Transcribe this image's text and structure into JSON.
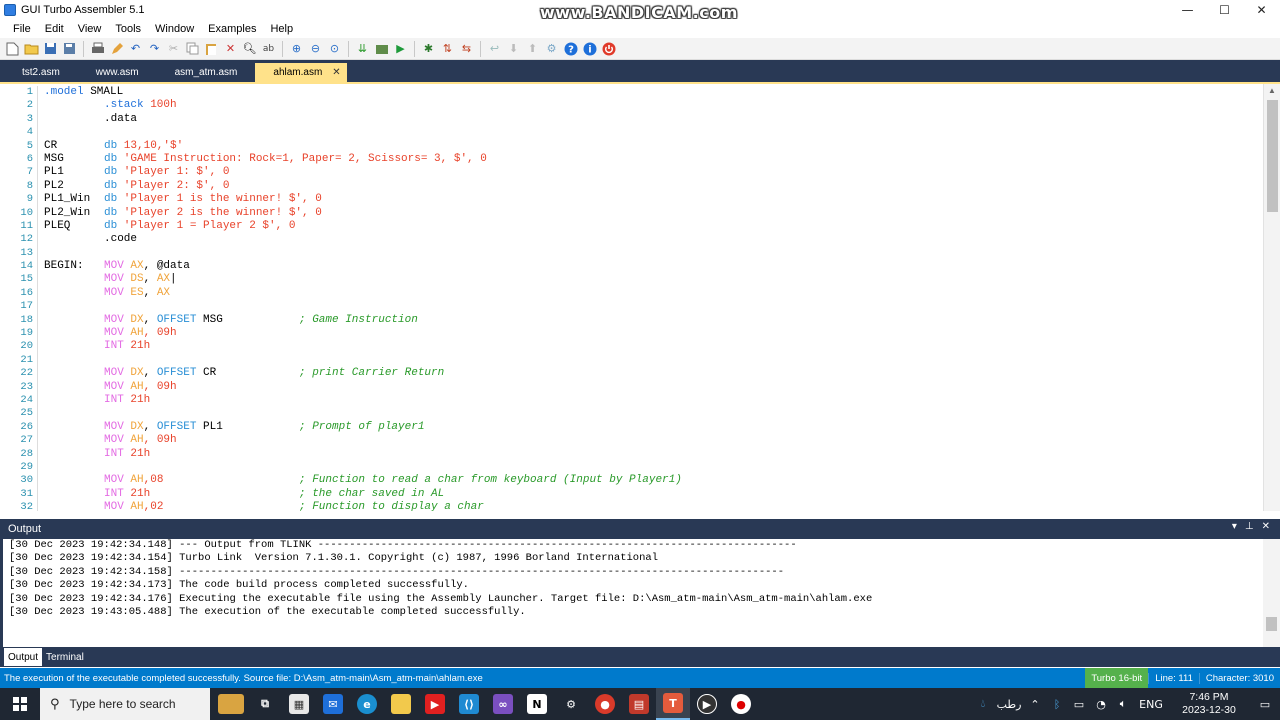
{
  "window": {
    "title": "GUI Turbo Assembler 5.1",
    "watermark": "www.BANDICAM.com",
    "controls": [
      "—",
      "☐",
      "✕"
    ]
  },
  "menu": [
    "File",
    "Edit",
    "View",
    "Tools",
    "Window",
    "Examples",
    "Help"
  ],
  "tabs": [
    {
      "label": "tst2.asm",
      "active": false
    },
    {
      "label": "www.asm",
      "active": false
    },
    {
      "label": "asm_atm.asm",
      "active": false
    },
    {
      "label": "ahlam.asm",
      "active": true
    }
  ],
  "editor": {
    "lines": [
      {
        "n": "1",
        "label": "",
        "body": [
          {
            "t": ".model",
            "c": "directive"
          },
          {
            "t": " SMALL",
            "c": "plain"
          }
        ],
        "noindent": true
      },
      {
        "n": "2",
        "label": "",
        "body": [
          {
            "t": ".stack",
            "c": "directive"
          },
          {
            "t": " 100h",
            "c": "num"
          }
        ]
      },
      {
        "n": "3",
        "label": "",
        "body": [
          {
            "t": ".data",
            "c": "plain"
          }
        ]
      },
      {
        "n": "4",
        "label": "",
        "body": []
      },
      {
        "n": "5",
        "label": "CR",
        "body": [
          {
            "t": "db",
            "c": "dbkw"
          },
          {
            "t": " 13,10,'$'",
            "c": "str"
          }
        ]
      },
      {
        "n": "6",
        "label": "MSG",
        "body": [
          {
            "t": "db",
            "c": "dbkw"
          },
          {
            "t": " 'GAME Instruction: Rock=1, Paper= 2, Scissors= 3, $', 0",
            "c": "str"
          }
        ]
      },
      {
        "n": "7",
        "label": "PL1",
        "body": [
          {
            "t": "db",
            "c": "dbkw"
          },
          {
            "t": " 'Player 1: $', 0",
            "c": "str"
          }
        ]
      },
      {
        "n": "8",
        "label": "PL2",
        "body": [
          {
            "t": "db",
            "c": "dbkw"
          },
          {
            "t": " 'Player 2: $', 0",
            "c": "str"
          }
        ]
      },
      {
        "n": "9",
        "label": "PL1_Win",
        "body": [
          {
            "t": "db",
            "c": "dbkw"
          },
          {
            "t": " 'Player 1 is the winner! $', 0",
            "c": "str"
          }
        ]
      },
      {
        "n": "10",
        "label": "PL2_Win",
        "body": [
          {
            "t": "db",
            "c": "dbkw"
          },
          {
            "t": " 'Player 2 is the winner! $', 0",
            "c": "str"
          }
        ]
      },
      {
        "n": "11",
        "label": "PLEQ",
        "body": [
          {
            "t": "db",
            "c": "dbkw"
          },
          {
            "t": " 'Player 1 = Player 2 $', 0",
            "c": "str"
          }
        ]
      },
      {
        "n": "12",
        "label": "",
        "body": [
          {
            "t": ".code",
            "c": "plain"
          }
        ]
      },
      {
        "n": "13",
        "label": "",
        "body": []
      },
      {
        "n": "14",
        "label": "BEGIN:",
        "body": [
          {
            "t": "MOV",
            "c": "kw"
          },
          {
            "t": " AX",
            "c": "reg"
          },
          {
            "t": ", @data",
            "c": "plain"
          }
        ]
      },
      {
        "n": "15",
        "label": "",
        "body": [
          {
            "t": "MOV",
            "c": "kw"
          },
          {
            "t": " DS",
            "c": "reg"
          },
          {
            "t": ", ",
            "c": "plain"
          },
          {
            "t": "AX",
            "c": "reg"
          },
          {
            "t": "|",
            "c": "plain"
          }
        ]
      },
      {
        "n": "16",
        "label": "",
        "body": [
          {
            "t": "MOV",
            "c": "kw"
          },
          {
            "t": " ES",
            "c": "reg"
          },
          {
            "t": ", ",
            "c": "plain"
          },
          {
            "t": "AX",
            "c": "reg"
          }
        ]
      },
      {
        "n": "17",
        "label": "",
        "body": []
      },
      {
        "n": "18",
        "label": "",
        "body": [
          {
            "t": "MOV",
            "c": "kw"
          },
          {
            "t": " DX",
            "c": "reg"
          },
          {
            "t": ", ",
            "c": "plain"
          },
          {
            "t": "OFFSET",
            "c": "dbkw"
          },
          {
            "t": " MSG",
            "c": "plain"
          }
        ],
        "comment": "; Game Instruction"
      },
      {
        "n": "19",
        "label": "",
        "body": [
          {
            "t": "MOV",
            "c": "kw"
          },
          {
            "t": " AH",
            "c": "reg"
          },
          {
            "t": ", 09h",
            "c": "num"
          }
        ]
      },
      {
        "n": "20",
        "label": "",
        "body": [
          {
            "t": "INT",
            "c": "kw"
          },
          {
            "t": " 21h",
            "c": "num"
          }
        ]
      },
      {
        "n": "21",
        "label": "",
        "body": []
      },
      {
        "n": "22",
        "label": "",
        "body": [
          {
            "t": "MOV",
            "c": "kw"
          },
          {
            "t": " DX",
            "c": "reg"
          },
          {
            "t": ", ",
            "c": "plain"
          },
          {
            "t": "OFFSET",
            "c": "dbkw"
          },
          {
            "t": " CR",
            "c": "plain"
          }
        ],
        "comment": "; print Carrier Return"
      },
      {
        "n": "23",
        "label": "",
        "body": [
          {
            "t": "MOV",
            "c": "kw"
          },
          {
            "t": " AH",
            "c": "reg"
          },
          {
            "t": ", 09h",
            "c": "num"
          }
        ]
      },
      {
        "n": "24",
        "label": "",
        "body": [
          {
            "t": "INT",
            "c": "kw"
          },
          {
            "t": " 21h",
            "c": "num"
          }
        ]
      },
      {
        "n": "25",
        "label": "",
        "body": []
      },
      {
        "n": "26",
        "label": "",
        "body": [
          {
            "t": "MOV",
            "c": "kw"
          },
          {
            "t": " DX",
            "c": "reg"
          },
          {
            "t": ", ",
            "c": "plain"
          },
          {
            "t": "OFFSET",
            "c": "dbkw"
          },
          {
            "t": " PL1",
            "c": "plain"
          }
        ],
        "comment": "; Prompt of player1"
      },
      {
        "n": "27",
        "label": "",
        "body": [
          {
            "t": "MOV",
            "c": "kw"
          },
          {
            "t": " AH",
            "c": "reg"
          },
          {
            "t": ", 09h",
            "c": "num"
          }
        ]
      },
      {
        "n": "28",
        "label": "",
        "body": [
          {
            "t": "INT",
            "c": "kw"
          },
          {
            "t": " 21h",
            "c": "num"
          }
        ]
      },
      {
        "n": "29",
        "label": "",
        "body": []
      },
      {
        "n": "30",
        "label": "",
        "body": [
          {
            "t": "MOV",
            "c": "kw"
          },
          {
            "t": " AH",
            "c": "reg"
          },
          {
            "t": ",08",
            "c": "num"
          }
        ],
        "comment": "; Function to read a char from keyboard (Input by Player1)"
      },
      {
        "n": "31",
        "label": "",
        "body": [
          {
            "t": "INT",
            "c": "kw"
          },
          {
            "t": " 21h",
            "c": "num"
          }
        ],
        "comment": "; the char saved in AL"
      },
      {
        "n": "32",
        "label": "",
        "body": [
          {
            "t": "MOV",
            "c": "kw"
          },
          {
            "t": " AH",
            "c": "reg"
          },
          {
            "t": ",02",
            "c": "num"
          }
        ],
        "comment": "; Function to display a char"
      }
    ]
  },
  "output": {
    "title": "Output",
    "controls": [
      "▾",
      "⊥",
      "✕"
    ],
    "lines": [
      "[30 Dec 2023 19:42:34.148] --- Output from TLINK ----------------------------------------------------------------------------",
      "[30 Dec 2023 19:42:34.154] Turbo Link  Version 7.1.30.1. Copyright (c) 1987, 1996 Borland International",
      "[30 Dec 2023 19:42:34.158] ------------------------------------------------------------------------------------------------",
      "[30 Dec 2023 19:42:34.173] The code build process completed successfully.",
      "[30 Dec 2023 19:42:34.176] Executing the executable file using the Assembly Launcher. Target file: D:\\Asm_atm-main\\Asm_atm-main\\ahlam.exe",
      "[30 Dec 2023 19:43:05.488] The execution of the executable completed successfully."
    ],
    "tabs": [
      {
        "label": "Output",
        "active": true
      },
      {
        "label": "Terminal",
        "active": false
      }
    ]
  },
  "status": {
    "message": "The execution of the executable completed successfully. Source file: D:\\Asm_atm-main\\Asm_atm-main\\ahlam.exe",
    "mode": "Turbo 16-bit",
    "line": "Line:  111",
    "character": "Character: 3010"
  },
  "taskbar": {
    "search_placeholder": "Type here to search",
    "language": "ENG",
    "time": "7:46 PM",
    "date": "2023-12-30",
    "weather_text": "رطب"
  },
  "colors": {
    "chrome": "#293955",
    "active_tab": "#ffe28a",
    "statusbar": "#007acc",
    "taskbar": "#1f2733"
  }
}
